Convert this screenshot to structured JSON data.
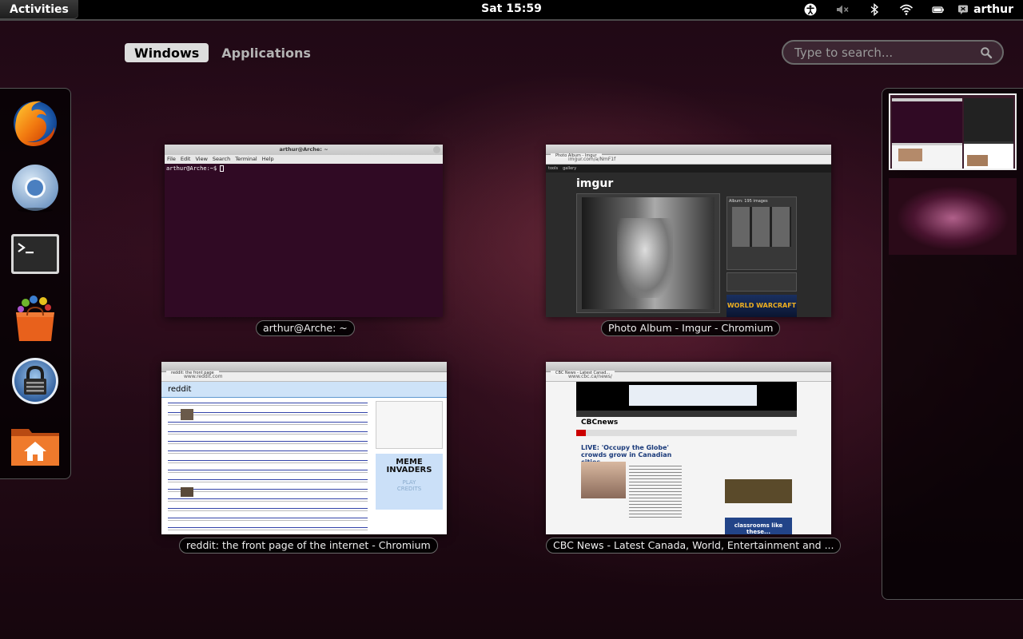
{
  "top_bar": {
    "activities_label": "Activities",
    "clock": "Sat 15:59",
    "indicators": [
      "accessibility-icon",
      "volume-muted-icon",
      "bluetooth-icon",
      "wifi-icon",
      "battery-icon"
    ],
    "user_name": "arthur"
  },
  "view_selector": {
    "tabs": [
      {
        "label": "Windows",
        "active": true
      },
      {
        "label": "Applications",
        "active": false
      }
    ]
  },
  "search": {
    "placeholder": "Type to search..."
  },
  "dash": {
    "items": [
      {
        "name": "firefox",
        "icon": "firefox-icon"
      },
      {
        "name": "chromium",
        "icon": "chromium-icon"
      },
      {
        "name": "terminal",
        "icon": "terminal-icon"
      },
      {
        "name": "software-center",
        "icon": "shopping-bag-icon"
      },
      {
        "name": "passwords-and-keys",
        "icon": "padlock-icon"
      },
      {
        "name": "home-folder",
        "icon": "home-folder-icon"
      }
    ]
  },
  "windows": [
    {
      "label": "arthur@Arche: ~",
      "app": "terminal",
      "title": "arthur@Arche: ~",
      "menu": [
        "File",
        "Edit",
        "View",
        "Search",
        "Terminal",
        "Help"
      ],
      "prompt": "arthur@Arche:~$ "
    },
    {
      "label": "Photo Album - Imgur - Chromium",
      "app": "chromium",
      "tab": "Photo Album - Imgur",
      "address": "imgur.com/a/NmF1f",
      "nav": [
        "tools",
        "gallery"
      ],
      "logo": "imgur",
      "album_text": "Album: 195 images",
      "game_ad": "WORLD WARCRAFT"
    },
    {
      "label": "reddit: the front page of the internet - Chromium",
      "app": "chromium",
      "tab": "reddit: the front page",
      "address": "www.reddit.com",
      "logo": "reddit",
      "ad_title": "MEME INVADERS",
      "ad_play": "PLAY",
      "ad_credits": "CREDITS"
    },
    {
      "label": "CBC News - Latest Canada, World, Entertainment and ...",
      "app": "chromium",
      "tab": "CBC News - Latest Canad...",
      "address": "www.cbc.ca/news/",
      "logo": "CBCnews",
      "headline": "LIVE: 'Occupy the Globe' crowds grow in Canadian cities",
      "side_ad": "classrooms like these..."
    }
  ],
  "colors": {
    "terminal_bg": "#300a24",
    "reddit_blue": "#cee3f8",
    "cbc_red": "#cc0000",
    "imgur_bg": "#2b2b2b"
  }
}
